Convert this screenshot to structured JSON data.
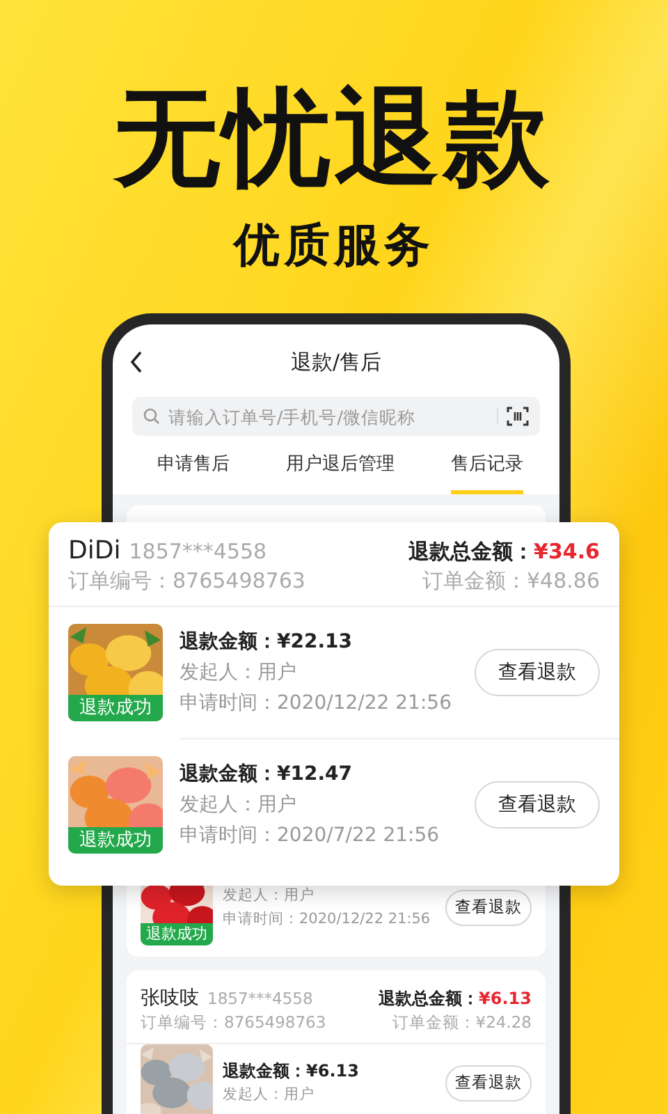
{
  "headline": "无忧退款",
  "subheadline": "优质服务",
  "app": {
    "title": "退款/售后",
    "search": {
      "placeholder": "请输入订单号/手机号/微信昵称"
    },
    "tabs": [
      {
        "label": "申请售后",
        "selected": false
      },
      {
        "label": "用户退后管理",
        "selected": false
      },
      {
        "label": "售后记录",
        "selected": true
      }
    ],
    "orders": [
      {
        "items": [
          {
            "status": "退款成功",
            "color": "#23a94b",
            "initiator": "发起人：用户",
            "time": "申请时间：2020/12/22 21:56",
            "button": "查看退款"
          }
        ]
      },
      {
        "customer": "张吱吱",
        "phone": "1857***4558",
        "total_label": "退款总金额：",
        "total": "¥6.13",
        "order_no": "订单编号：8765498763",
        "order_amount": "订单金额：¥24.28",
        "items": [
          {
            "amount_label": "退款金额：",
            "amount": "¥6.13",
            "initiator": "发起人：用户",
            "button": "查看退款"
          }
        ]
      }
    ]
  },
  "popup": {
    "customer": "DiDi",
    "phone": "1857***4558",
    "total_label": "退款总金额：",
    "total": "¥34.6",
    "order_no": "订单编号：8765498763",
    "order_amount": "订单金额：¥48.86",
    "items": [
      {
        "status": "退款成功",
        "color": "#23a94b",
        "amount_label": "退款金额：",
        "amount": "¥22.13",
        "initiator": "发起人：用户",
        "time": "申请时间：2020/12/22 21:56",
        "button": "查看退款"
      },
      {
        "status": "退款成功",
        "color": "#23a94b",
        "amount_label": "退款金额：",
        "amount": "¥12.47",
        "initiator": "发起人：用户",
        "time": "申请时间：2020/7/22 21:56",
        "button": "查看退款"
      }
    ]
  }
}
